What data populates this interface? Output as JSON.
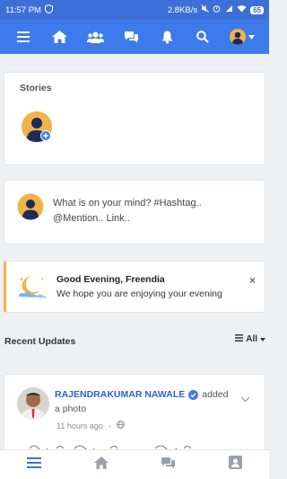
{
  "status_bar": {
    "time": "11:57 PM",
    "network_speed": "2.8KB/s",
    "battery": "65"
  },
  "top_nav": {
    "icons": [
      "menu-icon",
      "home-icon",
      "friends-icon",
      "chat-icon",
      "bell-icon",
      "search-icon",
      "avatar-icon",
      "chevron-down-icon"
    ]
  },
  "stories": {
    "title": "Stories"
  },
  "composer": {
    "prompt": "What is on your mind? #Hashtag.. @Mention.. Link.."
  },
  "greeting": {
    "title": "Good Evening, Freendia",
    "message": "We hope you are enjoying your evening",
    "close_label": "×"
  },
  "recent_updates": {
    "title": "Recent Updates",
    "filter_label": "All"
  },
  "post": {
    "author": "RAJENDRAKUMAR NAWALE",
    "action": "added",
    "object": "a photo",
    "time": "11 hours ago",
    "separator": "-"
  },
  "bottom_nav": {
    "icons": [
      "menu-icon",
      "home-icon",
      "messages-icon",
      "profile-card-icon"
    ]
  },
  "colors": {
    "primary": "#3d7aeb",
    "accent_gold": "#f2b24a",
    "link_blue": "#2f62c9"
  }
}
